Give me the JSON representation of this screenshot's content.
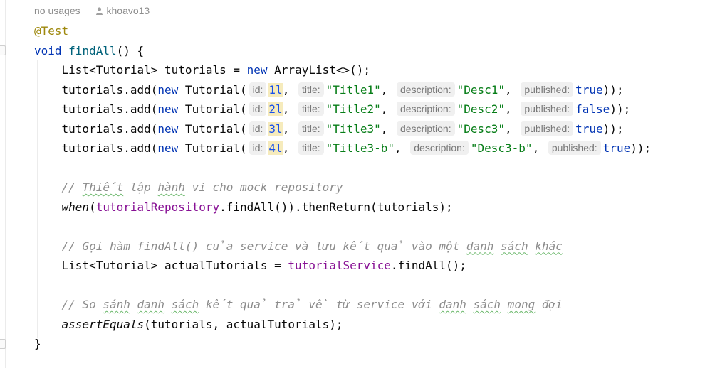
{
  "header": {
    "usages": "no usages",
    "author": "khoavo13"
  },
  "editor": {
    "annotation": "@Test",
    "signature": {
      "kw_void": "void",
      "method": "findAll",
      "rest": "() {"
    },
    "list_decl": {
      "type": "List<Tutorial>",
      "var": " tutorials = ",
      "kw_new": "new",
      "ctor": " ArrayList<>();"
    },
    "adds": [
      {
        "prefix": "tutorials.add(",
        "kw_new": "new",
        "ctor": " Tutorial(",
        "hint_id": "id:",
        "id": "1l",
        "sep1": ",",
        "hint_title": "title:",
        "title": "\"Title1\"",
        "sep2": ",",
        "hint_desc": "description:",
        "desc": "\"Desc1\"",
        "sep3": ",",
        "hint_pub": "published:",
        "pub": "true",
        "end": "));"
      },
      {
        "prefix": "tutorials.add(",
        "kw_new": "new",
        "ctor": " Tutorial(",
        "hint_id": "id:",
        "id": "2l",
        "sep1": ",",
        "hint_title": "title:",
        "title": "\"Title2\"",
        "sep2": ",",
        "hint_desc": "description:",
        "desc": "\"Desc2\"",
        "sep3": ",",
        "hint_pub": "published:",
        "pub": "false",
        "end": "));"
      },
      {
        "prefix": "tutorials.add(",
        "kw_new": "new",
        "ctor": " Tutorial(",
        "hint_id": "id:",
        "id": "3l",
        "sep1": ",",
        "hint_title": "title:",
        "title": "\"Title3\"",
        "sep2": ",",
        "hint_desc": "description:",
        "desc": "\"Desc3\"",
        "sep3": ",",
        "hint_pub": "published:",
        "pub": "true",
        "end": "));"
      },
      {
        "prefix": "tutorials.add(",
        "kw_new": "new",
        "ctor": " Tutorial(",
        "hint_id": "id:",
        "id": "4l",
        "sep1": ",",
        "hint_title": "title:",
        "title": "\"Title3-b\"",
        "sep2": ",",
        "hint_desc": "description:",
        "desc": "\"Desc3-b\"",
        "sep3": ",",
        "hint_pub": "published:",
        "pub": "true",
        "end": "));"
      }
    ],
    "comment1": {
      "w1": "// ",
      "w2": "Thiết",
      "w3": " lập ",
      "w4": "hành",
      "w5": " vi cho mock repository"
    },
    "when_line": {
      "fn": "when",
      "open": "(",
      "field": "tutorialRepository",
      "rest": ".findAll()).thenReturn(tutorials);"
    },
    "comment2": {
      "w1": "// Gọi hàm findAll() của service và lưu kết quả vào một ",
      "w2": "danh",
      "w3": " ",
      "w4": "sách",
      "w5": " ",
      "w6": "khác"
    },
    "actual_line": {
      "type": "List<Tutorial>",
      "var": " actualTutorials = ",
      "field": "tutorialService",
      "rest": ".findAll();"
    },
    "comment3": {
      "w1": "// So ",
      "w2": "sánh",
      "w3": " ",
      "w4": "danh",
      "w5": " ",
      "w6": "sách",
      "w7": " kết quả trả về từ service với ",
      "w8": "danh",
      "w9": " ",
      "w10": "sách",
      "w11": " ",
      "w12": "mong",
      "w13": " đợi"
    },
    "assert_line": {
      "fn": "assertEquals",
      "rest": "(tutorials, actualTutorials);"
    },
    "closing": "}"
  },
  "colors": {
    "keyword": "#0033b3",
    "string": "#067d17",
    "number": "#1750eb",
    "field": "#871094",
    "comment": "#8c8c8c",
    "annotation": "#9e880d"
  }
}
